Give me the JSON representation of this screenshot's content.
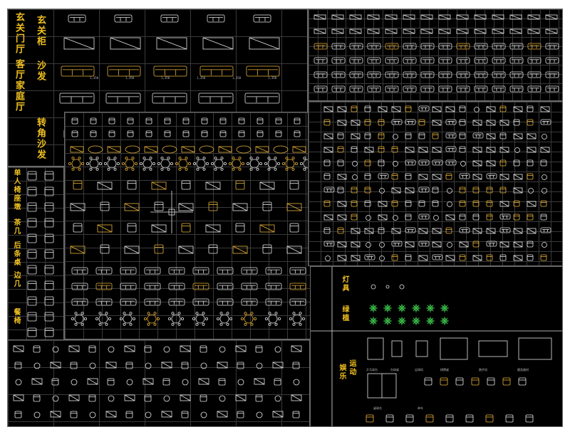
{
  "categories": {
    "foyer": "玄关门厅",
    "foyer_cabinet": "玄关柜",
    "living_family": "客厅家庭厅",
    "sofa": "沙发",
    "corner_sofa": "转角沙发",
    "single_chair": "单人椅座墩",
    "tea_table": "茶几",
    "back_table": "后条桌",
    "side_table": "边几",
    "dining_chair": "餐椅",
    "lamps": "灯具",
    "plants": "绿植",
    "sports": "运动",
    "entertainment": "娱乐"
  },
  "sofa_dimension_labels": [
    "1,350",
    "1,350",
    "1,350",
    "1,350",
    "1,350",
    "1,350"
  ],
  "sports_captions": [
    "乒乓球台",
    "台球桌",
    "足球机",
    "棋牌桌",
    "跑步机",
    "健身器材",
    "桌球台",
    "单车"
  ],
  "colors": {
    "background": "#000000",
    "grid_line": "#3a3a3a",
    "label_yellow": "#f0c020",
    "symbol_white": "#e6e6e6",
    "symbol_gold": "#e8b23a",
    "plant_green": "#3fcf4f"
  }
}
